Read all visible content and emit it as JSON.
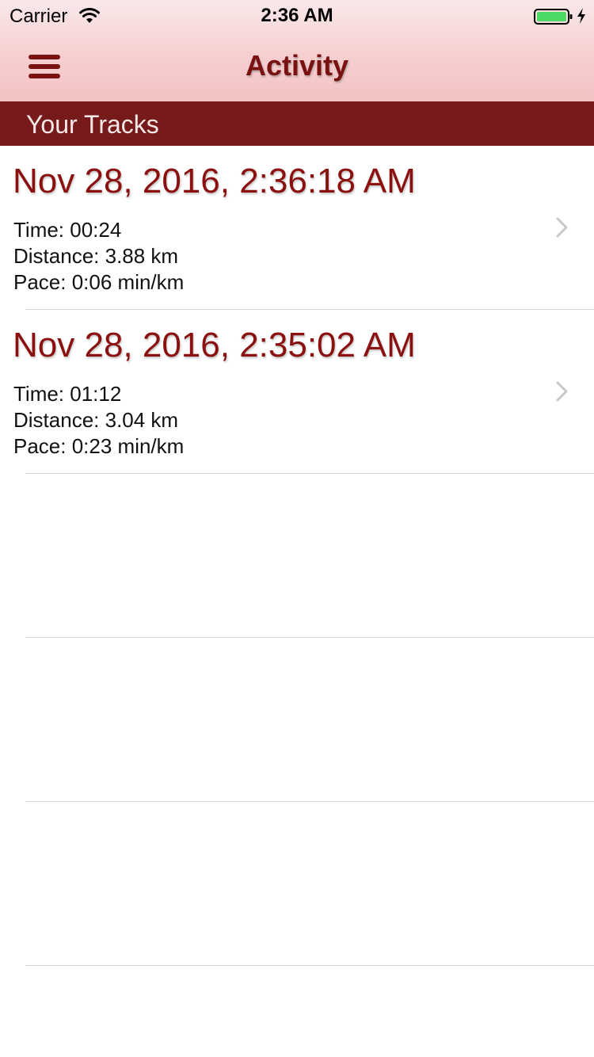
{
  "status_bar": {
    "carrier": "Carrier",
    "time": "2:36 AM",
    "battery_color": "#4cd964"
  },
  "nav": {
    "title": "Activity",
    "menu_icon": "hamburger-menu-icon",
    "accent_color": "#7a1111"
  },
  "section": {
    "title": "Your Tracks",
    "background": "#761a1b"
  },
  "tracks": [
    {
      "date": "Nov 28, 2016, 2:36:18 AM",
      "time": "Time: 00:24",
      "distance": "Distance: 3.88 km",
      "pace": "Pace: 0:06 min/km"
    },
    {
      "date": "Nov 28, 2016, 2:35:02 AM",
      "time": "Time: 01:12",
      "distance": "Distance: 3.04 km",
      "pace": "Pace: 0:23 min/km"
    }
  ]
}
